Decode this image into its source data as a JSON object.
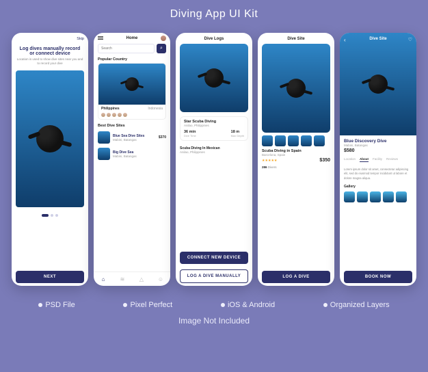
{
  "page": {
    "title": "Diving App UI Kit",
    "features": [
      "PSD File",
      "Pixel Perfect",
      "iOS & Android",
      "Organized Layers"
    ],
    "note": "Image Not Included"
  },
  "onboard": {
    "skip": "Skip",
    "title": "Log dives manually record or connect device",
    "subtitle": "Location is used to show dive sites near you and to record your dive",
    "next": "NEXT"
  },
  "home": {
    "title": "Home",
    "search_placeholder": "Search",
    "popular_label": "Popular Country",
    "country1": "Philippines",
    "country2": "Indonesia",
    "best_label": "Best Dive Sites",
    "sites": [
      {
        "name": "Blue Sea Dive Sites",
        "loc": "Mabini, Batangas",
        "price": "$370"
      },
      {
        "name": "Big Dive Sea",
        "loc": "Mabini, Batangas",
        "price": ""
      }
    ]
  },
  "logs": {
    "title": "Dive Logs",
    "card": {
      "name": "Star Scuba Diving",
      "loc": "Anilao, Philippines",
      "stats": [
        {
          "v": "36 min",
          "l": "Dive Time"
        },
        {
          "v": "18 m",
          "l": "Max Depth"
        }
      ]
    },
    "mini": {
      "name": "Scuba Diving In Mexican",
      "loc": "Anilao, Philippines"
    },
    "connect": "CONNECT NEW DEVICE",
    "manual": "LOG A DIVE MANUALLY"
  },
  "site": {
    "title": "Dive Site",
    "name": "Scuba Diving in Spain",
    "loc": "Barcelona, Spain",
    "price": "$350",
    "stats": [
      {
        "v": "286",
        "l": "Divers"
      },
      {
        "v": "",
        "l": ""
      }
    ],
    "log_btn": "LOG A DIVE"
  },
  "detail": {
    "title": "Dive Site",
    "name": "Blue Discovery Dive",
    "loc": "Mabini, Batangas",
    "price": "$580",
    "tabs": [
      "Location",
      "About",
      "Facility",
      "Reviews"
    ],
    "active_tab": "About",
    "para": "Lorem ipsum dolor sit amet, consectetur adipiscing elit, sed do eiusmod tempor incididunt ut labore et dolore magna aliqua.",
    "gallery_label": "Gallery",
    "book": "BOOK NOW"
  }
}
